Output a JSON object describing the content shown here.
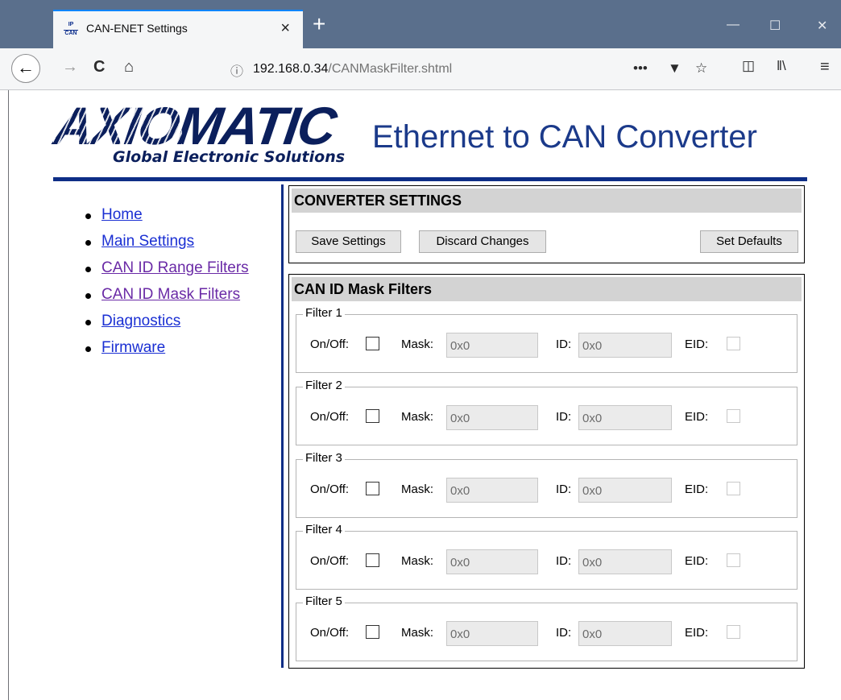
{
  "browser": {
    "tab_title": "CAN-ENET Settings",
    "tab_close": "×",
    "favicon_top": "IP",
    "favicon_bottom": "CAN",
    "new_tab": "+",
    "url_host": "192.168.0.34",
    "url_path": "/CANMaskFilter.shtml",
    "window_minimize": "—",
    "window_maximize": "☐",
    "window_close": "✕",
    "more_actions": "•••"
  },
  "header": {
    "logo_text": "AXIOMATIC",
    "logo_tagline": "Global Electronic Solutions",
    "title": "Ethernet to CAN Converter"
  },
  "sidenav": {
    "items": [
      {
        "label": "Home"
      },
      {
        "label": "Main Settings"
      },
      {
        "label": "CAN ID Range Filters"
      },
      {
        "label": "CAN ID Mask Filters"
      },
      {
        "label": "Diagnostics"
      },
      {
        "label": "Firmware"
      }
    ]
  },
  "converter_settings": {
    "title": "CONVERTER SETTINGS",
    "save_label": "Save Settings",
    "discard_label": "Discard Changes",
    "defaults_label": "Set Defaults"
  },
  "mask_filters": {
    "title": "CAN ID Mask Filters",
    "onoff_label": "On/Off:",
    "mask_label": "Mask:",
    "id_label": "ID:",
    "eid_label": "EID:",
    "filters": [
      {
        "name": "Filter 1",
        "mask": "0x0",
        "id": "0x0"
      },
      {
        "name": "Filter 2",
        "mask": "0x0",
        "id": "0x0"
      },
      {
        "name": "Filter 3",
        "mask": "0x0",
        "id": "0x0"
      },
      {
        "name": "Filter 4",
        "mask": "0x0",
        "id": "0x0"
      },
      {
        "name": "Filter 5",
        "mask": "0x0",
        "id": "0x0"
      }
    ]
  }
}
